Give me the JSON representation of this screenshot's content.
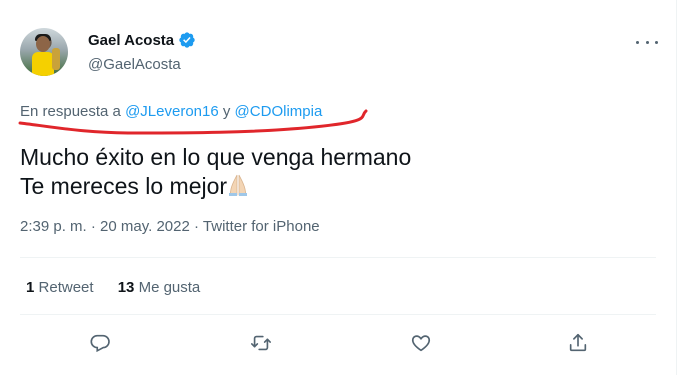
{
  "author": {
    "name": "Gael Acosta",
    "handle": "@GaelAcosta"
  },
  "reply": {
    "prefix": "En respuesta a",
    "user1": "@JLeveron16",
    "conj": "y",
    "user2": "@CDOlimpia"
  },
  "tweet": {
    "line1": "Mucho éxito en lo que venga hermano",
    "line2": "Te mereces lo mejor"
  },
  "meta": {
    "time": "2:39 p. m.",
    "sep1": "·",
    "date": "20 may. 2022",
    "sep2": "·",
    "source": "Twitter for iPhone"
  },
  "stats": {
    "retweets_count": "1",
    "retweets_label": "Retweet",
    "likes_count": "13",
    "likes_label": "Me gusta"
  },
  "colors": {
    "link": "#1d9bf0",
    "muted": "#536471",
    "text": "#0f1419",
    "annotation": "#e0262b"
  },
  "icons": [
    "verified-badge-icon",
    "more-icon",
    "reply-icon",
    "retweet-icon",
    "like-icon",
    "share-icon",
    "pray-emoji-icon"
  ]
}
